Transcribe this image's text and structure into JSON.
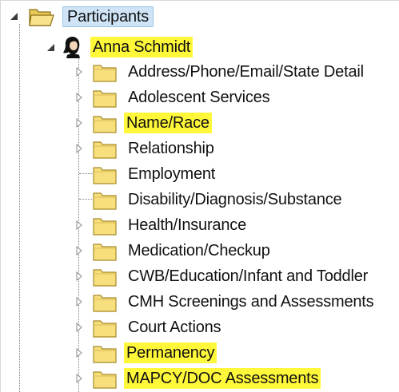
{
  "colors": {
    "highlight": "#fff83a",
    "selection": "#cfe4f6",
    "folder": "#f7df7d"
  },
  "tree": {
    "root": {
      "label": "Participants",
      "icon": "folder-open-icon",
      "expanded": true
    },
    "participant": {
      "label": "Anna Schmidt",
      "icon": "person-icon",
      "expanded": true,
      "highlighted": true
    },
    "items": [
      {
        "label": "Address/Phone/Email/State Detail",
        "icon": "folder-icon",
        "has_children": true,
        "highlighted": false
      },
      {
        "label": "Adolescent Services",
        "icon": "folder-icon",
        "has_children": true,
        "highlighted": false
      },
      {
        "label": "Name/Race",
        "icon": "folder-icon",
        "has_children": true,
        "highlighted": true
      },
      {
        "label": "Relationship",
        "icon": "folder-icon",
        "has_children": true,
        "highlighted": false
      },
      {
        "label": "Employment",
        "icon": "folder-icon",
        "has_children": false,
        "highlighted": false
      },
      {
        "label": "Disability/Diagnosis/Substance",
        "icon": "folder-icon",
        "has_children": false,
        "highlighted": false
      },
      {
        "label": "Health/Insurance",
        "icon": "folder-icon",
        "has_children": true,
        "highlighted": false
      },
      {
        "label": "Medication/Checkup",
        "icon": "folder-icon",
        "has_children": true,
        "highlighted": false
      },
      {
        "label": "CWB/Education/Infant and Toddler",
        "icon": "folder-icon",
        "has_children": true,
        "highlighted": false
      },
      {
        "label": "CMH Screenings and Assessments",
        "icon": "folder-icon",
        "has_children": true,
        "highlighted": false
      },
      {
        "label": "Court Actions",
        "icon": "folder-icon",
        "has_children": true,
        "highlighted": false
      },
      {
        "label": "Permanency",
        "icon": "folder-icon",
        "has_children": true,
        "highlighted": true
      },
      {
        "label": "MAPCY/DOC Assessments",
        "icon": "folder-icon",
        "has_children": true,
        "highlighted": true
      }
    ]
  }
}
